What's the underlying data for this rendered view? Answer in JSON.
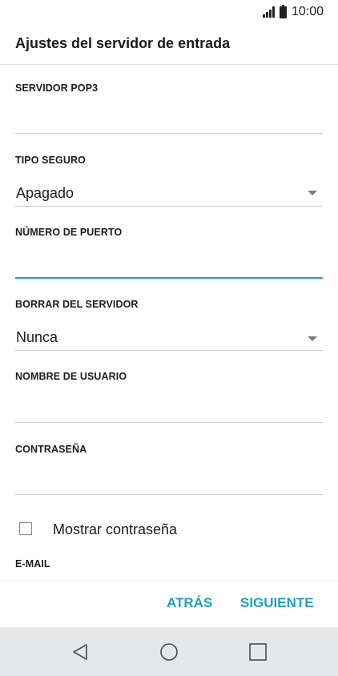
{
  "status_bar": {
    "time": "10:00",
    "signal_icon": "signal-icon",
    "battery_icon": "battery-icon"
  },
  "app_bar": {
    "title": "Ajustes del servidor de entrada"
  },
  "form": {
    "pop3_server": {
      "label": "SERVIDOR POP3",
      "value": ""
    },
    "security_type": {
      "label": "TIPO SEGURO",
      "value": "Apagado"
    },
    "port_number": {
      "label": "NÚMERO DE PUERTO",
      "value": ""
    },
    "delete_from_server": {
      "label": "BORRAR DEL SERVIDOR",
      "value": "Nunca"
    },
    "username": {
      "label": "NOMBRE DE USUARIO",
      "value": ""
    },
    "password": {
      "label": "CONTRASEÑA",
      "value": ""
    },
    "show_password": {
      "label": "Mostrar contraseña",
      "checked": false
    },
    "email": {
      "label": "E-MAIL"
    }
  },
  "actions": {
    "back_label": "ATRÁS",
    "next_label": "SIGUIENTE"
  },
  "nav_bar": {
    "back_icon": "back-triangle-icon",
    "home_icon": "home-circle-icon",
    "recents_icon": "recents-square-icon"
  },
  "colors": {
    "accent": "#1fa3b5",
    "nav_background": "#e6e7ea"
  }
}
